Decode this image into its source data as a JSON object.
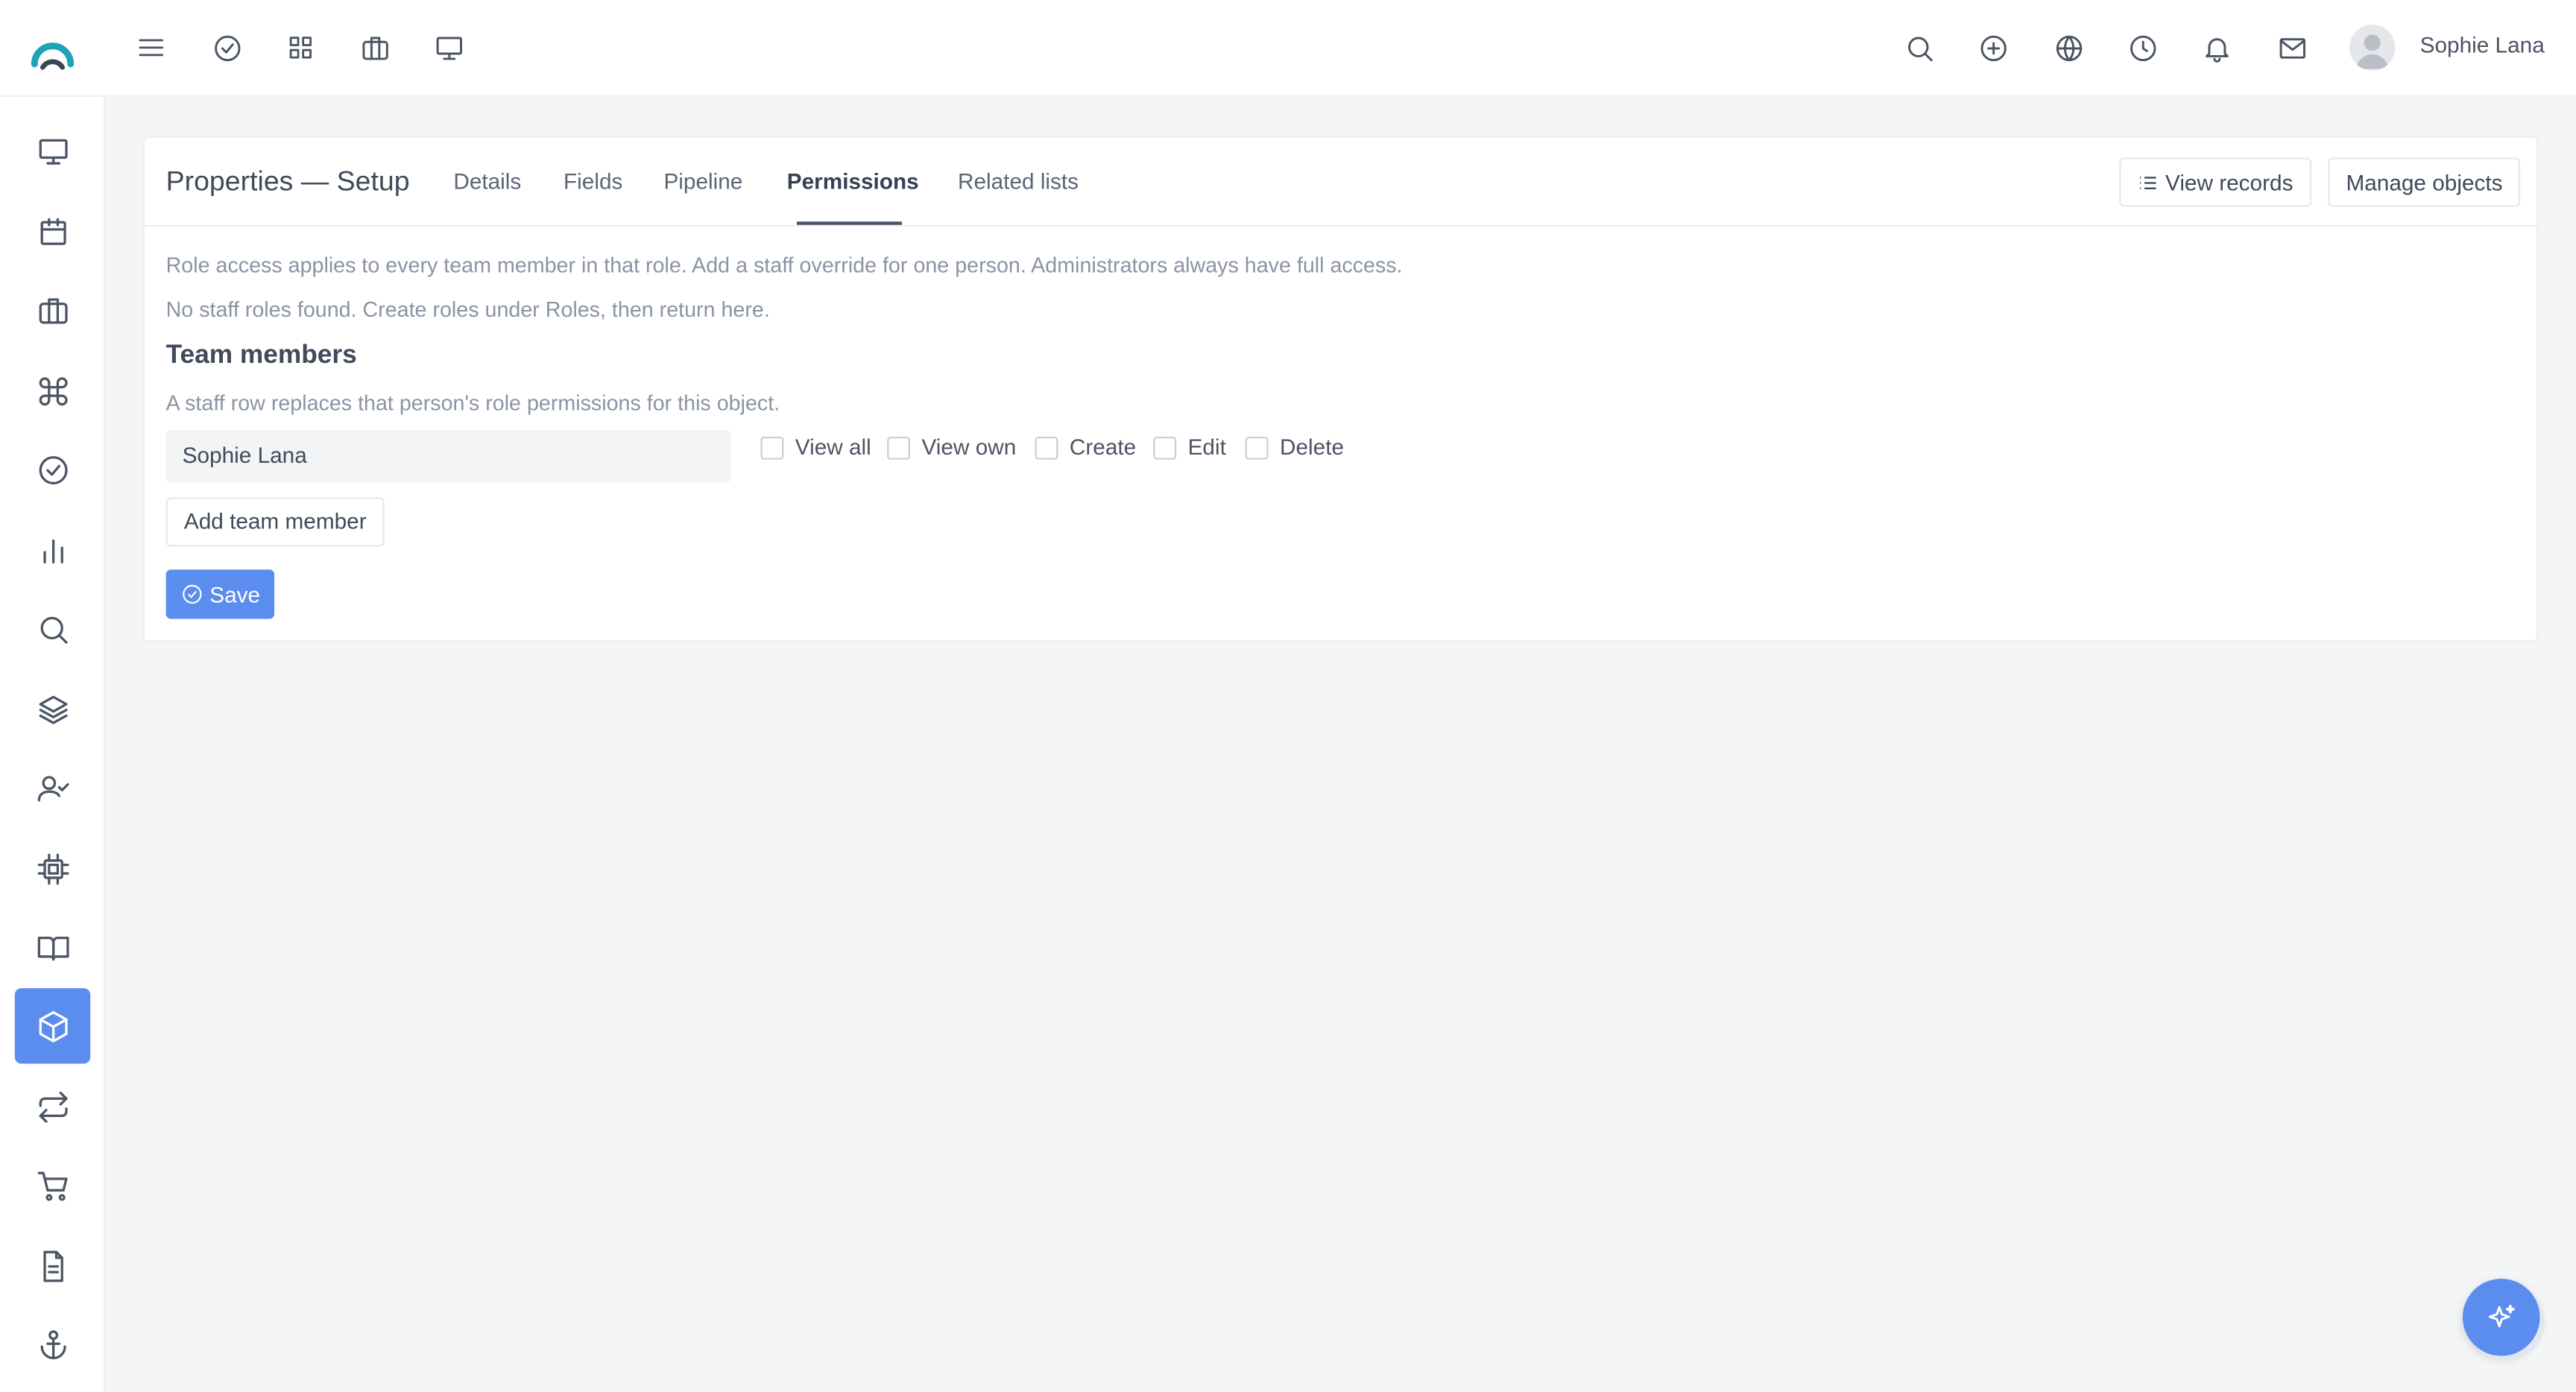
{
  "user": {
    "name": "Sophie Lana"
  },
  "page": {
    "title": "Properties — Setup",
    "tabs": [
      {
        "label": "Details",
        "active": false
      },
      {
        "label": "Fields",
        "active": false
      },
      {
        "label": "Pipeline",
        "active": false
      },
      {
        "label": "Permissions",
        "active": true
      },
      {
        "label": "Related lists",
        "active": false
      }
    ],
    "view_records_label": "View records",
    "manage_objects_label": "Manage objects"
  },
  "permissions": {
    "intro": "Role access applies to every team member in that role. Add a staff override for one person. Administrators always have full access.",
    "no_roles": "No staff roles found. Create roles under Roles, then return here.",
    "team_title": "Team members",
    "team_help": "A staff row replaces that person's role permissions for this object.",
    "member": "Sophie Lana",
    "checkboxes": [
      {
        "label": "View all",
        "checked": false
      },
      {
        "label": "View own",
        "checked": false
      },
      {
        "label": "Create",
        "checked": false
      },
      {
        "label": "Edit",
        "checked": false
      },
      {
        "label": "Delete",
        "checked": false
      }
    ],
    "add_member_label": "Add team member",
    "save_label": "Save"
  },
  "theme": {
    "accent": "#5b8def"
  },
  "icons": {
    "topbar": [
      "menu-icon",
      "check-circle-icon",
      "grid-icon",
      "briefcase-icon",
      "monitor-icon",
      "search-icon",
      "plus-circle-icon",
      "globe-icon",
      "clock-icon",
      "bell-icon",
      "mail-icon"
    ],
    "sidebar": [
      "monitor-icon",
      "calendar-icon",
      "briefcase-icon",
      "command-icon",
      "check-circle-icon",
      "bar-chart-icon",
      "search-icon",
      "layers-icon",
      "user-check-icon",
      "cpu-icon",
      "book-open-icon",
      "box-icon",
      "repeat-icon",
      "shopping-cart-icon",
      "file-text-icon",
      "anchor-icon"
    ],
    "sidebar_active": "box-icon"
  }
}
